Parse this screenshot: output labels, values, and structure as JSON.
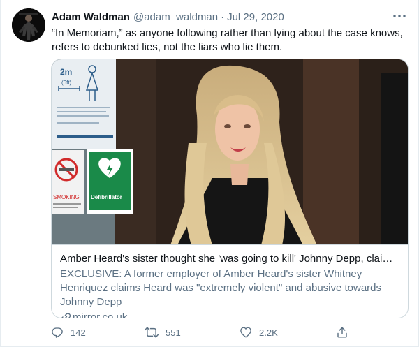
{
  "author": {
    "name": "Adam Waldman",
    "handle": "@adam_waldman",
    "separator": "·",
    "date": "Jul 29, 2020"
  },
  "tweet": {
    "text": "“In Memoriam,” as anyone following rather than lying about the case knows, refers to debunked lies, not the liars who lie them."
  },
  "card": {
    "image_signs": {
      "floor": "2m",
      "floor_sub": "(6ft)",
      "smoking": "SMOKING",
      "defibrillator": "Defibrillator"
    },
    "title": "Amber Heard's sister thought she 'was going to kill' Johnny Depp, claims wit...",
    "description": "EXCLUSIVE: A former employer of Amber Heard's sister Whitney Henriquez claims Heard was \"extremely violent\" and abusive towards Johnny Depp",
    "domain": "mirror.co.uk"
  },
  "actions": {
    "replies": "142",
    "retweets": "551",
    "likes": "2.2K"
  },
  "icons": {
    "more": "more-icon",
    "link": "link-icon",
    "reply": "reply-icon",
    "retweet": "retweet-icon",
    "like": "like-icon",
    "share": "share-icon"
  },
  "colors": {
    "text": "#0f1419",
    "secondary": "#5b7083",
    "border": "#cfd9de"
  }
}
